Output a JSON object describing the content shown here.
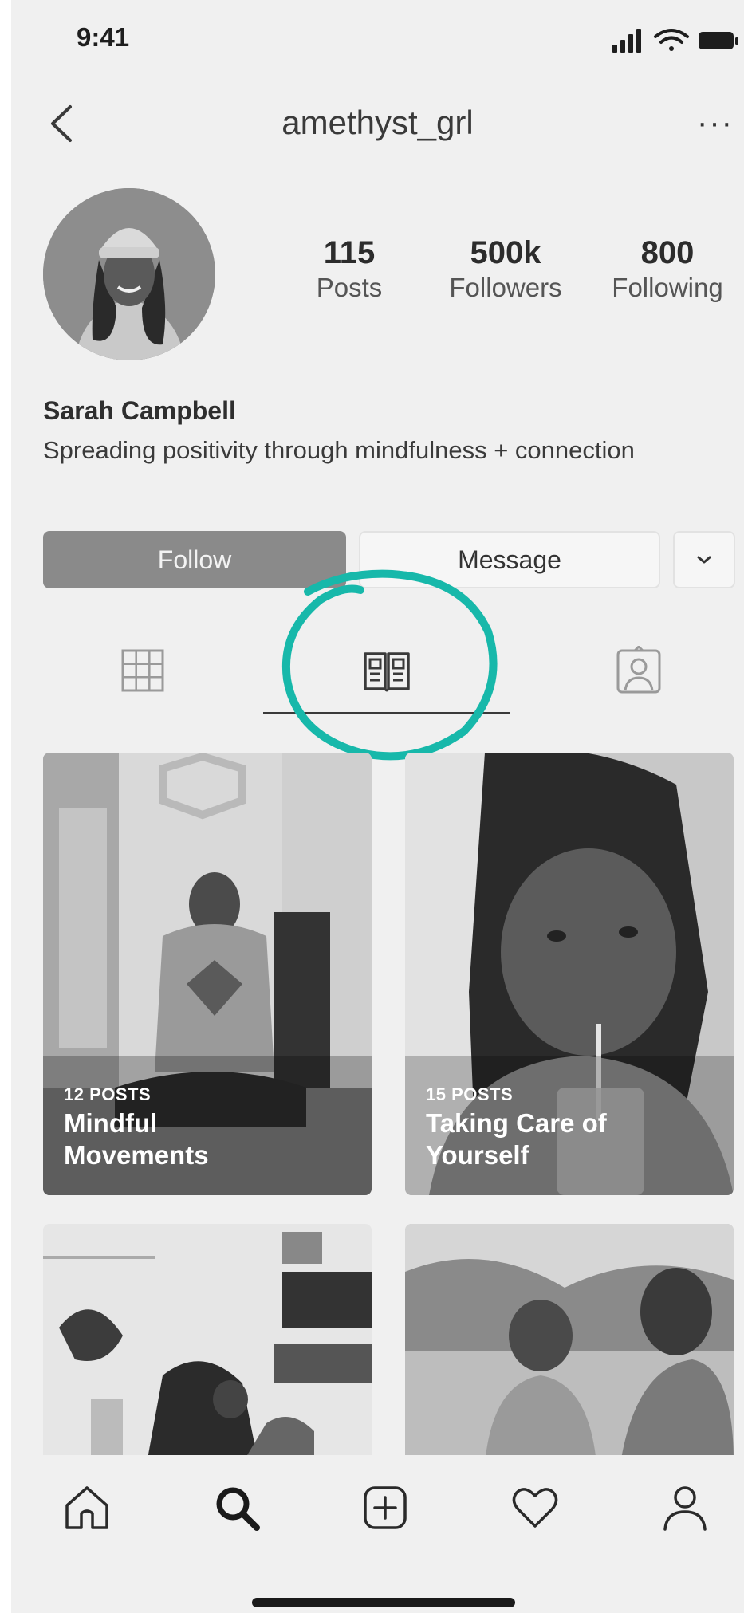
{
  "status_bar": {
    "time": "9:41"
  },
  "header": {
    "username": "amethyst_grl",
    "more_label": "···"
  },
  "profile": {
    "stats": [
      {
        "value": "115",
        "label": "Posts"
      },
      {
        "value": "500k",
        "label": "Followers"
      },
      {
        "value": "800",
        "label": "Following"
      }
    ],
    "name": "Sarah Campbell",
    "bio": "Spreading positivity through mindfulness + connection"
  },
  "actions": {
    "follow_label": "Follow",
    "message_label": "Message"
  },
  "tabs": [
    {
      "icon": "grid-icon",
      "active": false
    },
    {
      "icon": "guides-icon",
      "active": true
    },
    {
      "icon": "tagged-icon",
      "active": false
    }
  ],
  "guides": [
    {
      "count": "12 POSTS",
      "title_line1": "Mindful",
      "title_line2": "Movements"
    },
    {
      "count": "15 POSTS",
      "title_line1": "Taking Care of",
      "title_line2": "Yourself"
    },
    {
      "count": "",
      "title_line1": "",
      "title_line2": ""
    },
    {
      "count": "",
      "title_line1": "",
      "title_line2": ""
    }
  ],
  "bottom_nav": [
    "home-icon",
    "search-icon",
    "add-post-icon",
    "activity-heart-icon",
    "profile-icon"
  ],
  "colors": {
    "background": "#f0f0f0",
    "follow_button": "#8a8a8a",
    "highlight_circle": "#17b8aa"
  }
}
